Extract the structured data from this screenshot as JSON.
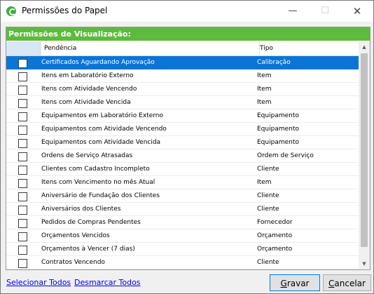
{
  "window": {
    "title": "Permissões do Papel",
    "min_glyph": "—",
    "max_glyph": "☐",
    "close_glyph": "✕"
  },
  "panel": {
    "header": "Permissões de Visualização:"
  },
  "grid": {
    "columns": {
      "pendencia": "Pendência",
      "tipo": "Tipo"
    },
    "rows": [
      {
        "pendencia": "Certificados Aguardando Aprovação",
        "tipo": "Calibração",
        "checked": false,
        "selected": true
      },
      {
        "pendencia": "Itens em Laboratório Externo",
        "tipo": "Item",
        "checked": false,
        "selected": false
      },
      {
        "pendencia": "Itens com Atividade Vencendo",
        "tipo": "Item",
        "checked": false,
        "selected": false
      },
      {
        "pendencia": "Itens com Atividade Vencida",
        "tipo": "Item",
        "checked": false,
        "selected": false
      },
      {
        "pendencia": "Equipamentos em Laboratório Externo",
        "tipo": "Equipamento",
        "checked": false,
        "selected": false
      },
      {
        "pendencia": "Equipamentos com Atividade Vencendo",
        "tipo": "Equipamento",
        "checked": false,
        "selected": false
      },
      {
        "pendencia": "Equipamentos com Atividade Vencida",
        "tipo": "Equipamento",
        "checked": false,
        "selected": false
      },
      {
        "pendencia": "Ordens de Serviço Atrasadas",
        "tipo": "Ordem de Serviço",
        "checked": false,
        "selected": false
      },
      {
        "pendencia": "Clientes com Cadastro Incompleto",
        "tipo": "Cliente",
        "checked": false,
        "selected": false
      },
      {
        "pendencia": "Itens com Vencimento no mês Atual",
        "tipo": "Item",
        "checked": false,
        "selected": false
      },
      {
        "pendencia": "Aniversário de Fundação dos Clientes",
        "tipo": "Cliente",
        "checked": false,
        "selected": false
      },
      {
        "pendencia": "Aniversários dos Clientes",
        "tipo": "Cliente",
        "checked": false,
        "selected": false
      },
      {
        "pendencia": "Pedidos de Compras Pendentes",
        "tipo": "Fornecedor",
        "checked": false,
        "selected": false
      },
      {
        "pendencia": "Orçamentos Vencidos",
        "tipo": "Orçamento",
        "checked": false,
        "selected": false
      },
      {
        "pendencia": "Orçamentos à Vencer (7 dias)",
        "tipo": "Orçamento",
        "checked": false,
        "selected": false
      },
      {
        "pendencia": "Contratos Vencendo",
        "tipo": "Cliente",
        "checked": false,
        "selected": false
      }
    ]
  },
  "scrollbar": {
    "up_glyph": "▲",
    "down_glyph": "▼"
  },
  "links": {
    "select_all": "Selecionar Todos",
    "deselect_all": "Desmarcar Todos"
  },
  "buttons": {
    "save": {
      "accel": "G",
      "rest": "ravar"
    },
    "cancel": {
      "accel": "C",
      "rest": "ancelar"
    }
  },
  "colors": {
    "header_green": "#5cbb3c",
    "selection_blue": "#0b75d6",
    "link_blue": "#0000e6"
  }
}
